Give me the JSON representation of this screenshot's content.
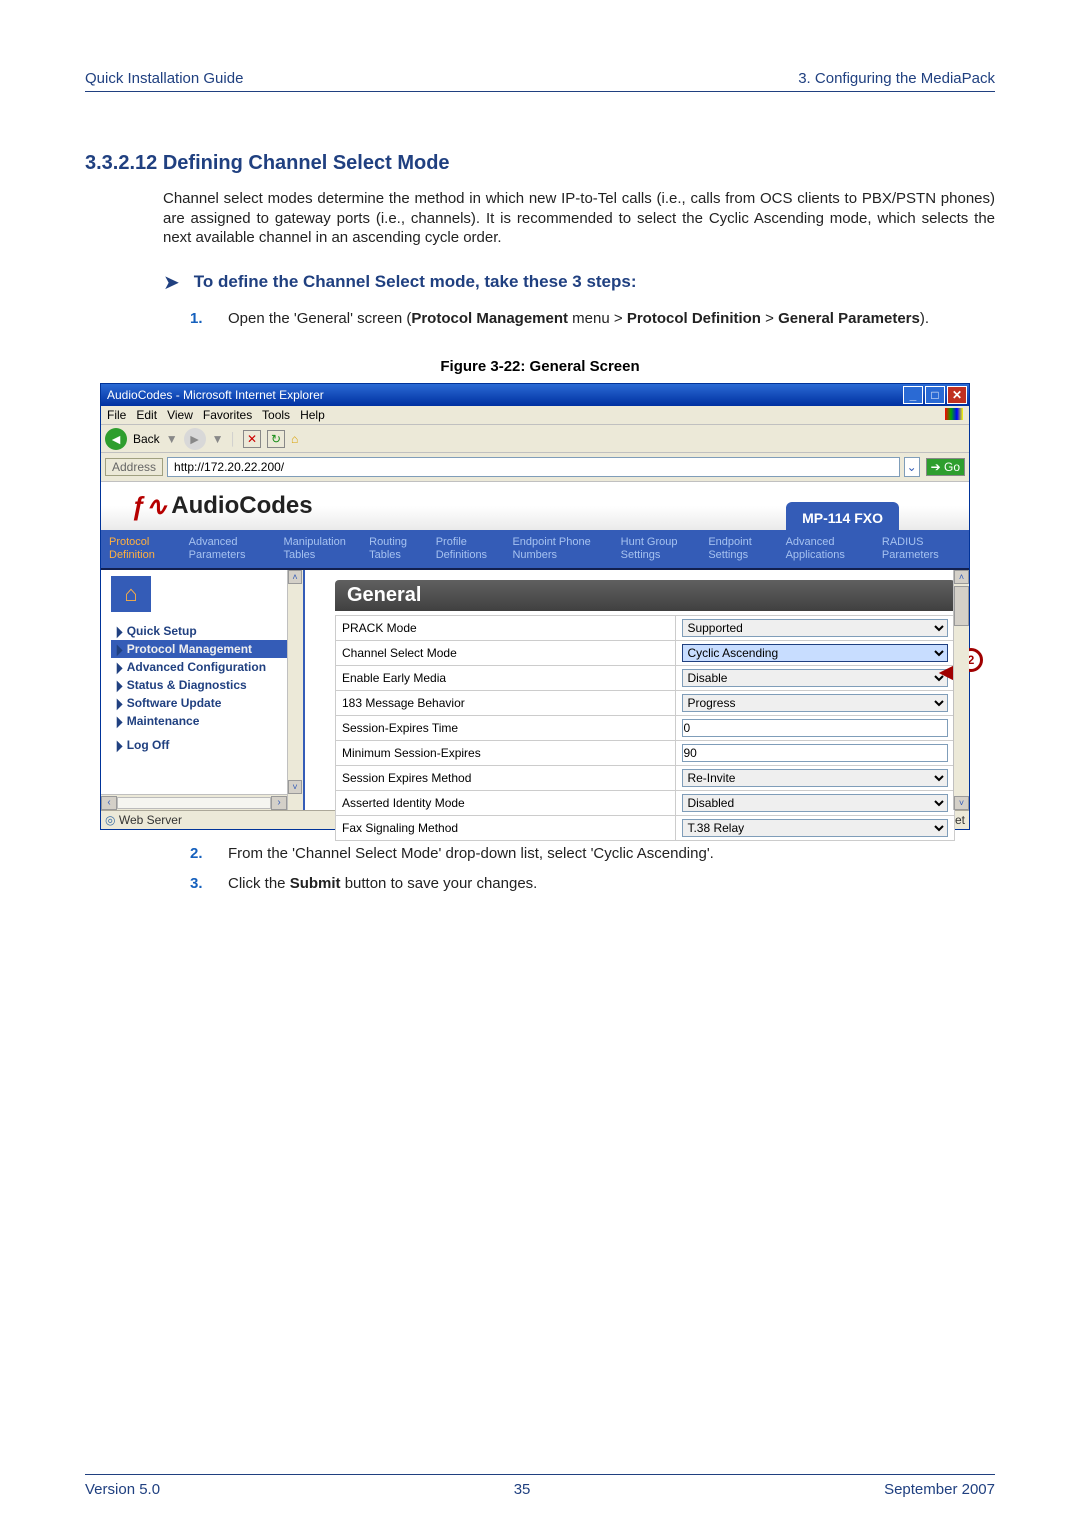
{
  "header": {
    "left": "Quick Installation Guide",
    "right": "3. Configuring the MediaPack"
  },
  "section": {
    "number": "3.3.2.12  Defining Channel Select Mode",
    "intro": "Channel select modes determine the method in which new IP-to-Tel calls (i.e., calls from OCS clients to PBX/PSTN phones) are assigned to gateway ports (i.e., channels). It is recommended to select the Cyclic Ascending mode, which selects the next available channel in an ascending cycle order.",
    "procedure_title": "To define the Channel Select mode, take these 3 steps:"
  },
  "steps": {
    "s1_pre": "Open the 'General' screen (",
    "s1_b1": "Protocol Management",
    "s1_mid1": " menu > ",
    "s1_b2": "Protocol Definition",
    "s1_mid2": " > ",
    "s1_b3": "General Parameters",
    "s1_post": ").",
    "s2": "From the 'Channel Select Mode' drop-down list, select 'Cyclic Ascending'.",
    "s3_pre": "Click the ",
    "s3_b": "Submit",
    "s3_post": " button to save your changes."
  },
  "figure_caption": "Figure 3-22: General Screen",
  "ie": {
    "title": "AudioCodes - Microsoft Internet Explorer",
    "menu": [
      "File",
      "Edit",
      "View",
      "Favorites",
      "Tools",
      "Help"
    ],
    "back": "Back",
    "address_label": "Address",
    "url": "http://172.20.22.200/",
    "go": "Go",
    "status_left": "Web Server",
    "status_right": "Internet"
  },
  "app": {
    "logo": "AudioCodes",
    "product": "MP-114 FXO",
    "tabs": [
      "Protocol Definition",
      "Advanced Parameters",
      "Manipulation Tables",
      "Routing Tables",
      "Profile Definitions",
      "Endpoint Phone Numbers",
      "Hunt Group Settings",
      "Endpoint Settings",
      "Advanced Applications",
      "RADIUS Parameters"
    ],
    "sidebar": {
      "items": [
        "Quick Setup",
        "Protocol Management",
        "Advanced Configuration",
        "Status & Diagnostics",
        "Software Update",
        "Maintenance"
      ],
      "logoff": "Log Off"
    },
    "main_title": "General",
    "rows": [
      {
        "label": "PRACK Mode",
        "value": "Supported",
        "type": "select"
      },
      {
        "label": "Channel Select Mode",
        "value": "Cyclic Ascending",
        "type": "select",
        "highlight": true
      },
      {
        "label": "Enable Early Media",
        "value": "Disable",
        "type": "select"
      },
      {
        "label": "183 Message Behavior",
        "value": "Progress",
        "type": "select"
      },
      {
        "label": "Session-Expires Time",
        "value": "0",
        "type": "input"
      },
      {
        "label": "Minimum Session-Expires",
        "value": "90",
        "type": "input"
      },
      {
        "label": "Session Expires Method",
        "value": "Re-Invite",
        "type": "select"
      },
      {
        "label": "Asserted Identity Mode",
        "value": "Disabled",
        "type": "select"
      },
      {
        "label": "Fax Signaling Method",
        "value": "T.38 Relay",
        "type": "select"
      }
    ],
    "callout": "2"
  },
  "footer": {
    "left": "Version 5.0",
    "center": "35",
    "right": "September 2007"
  }
}
